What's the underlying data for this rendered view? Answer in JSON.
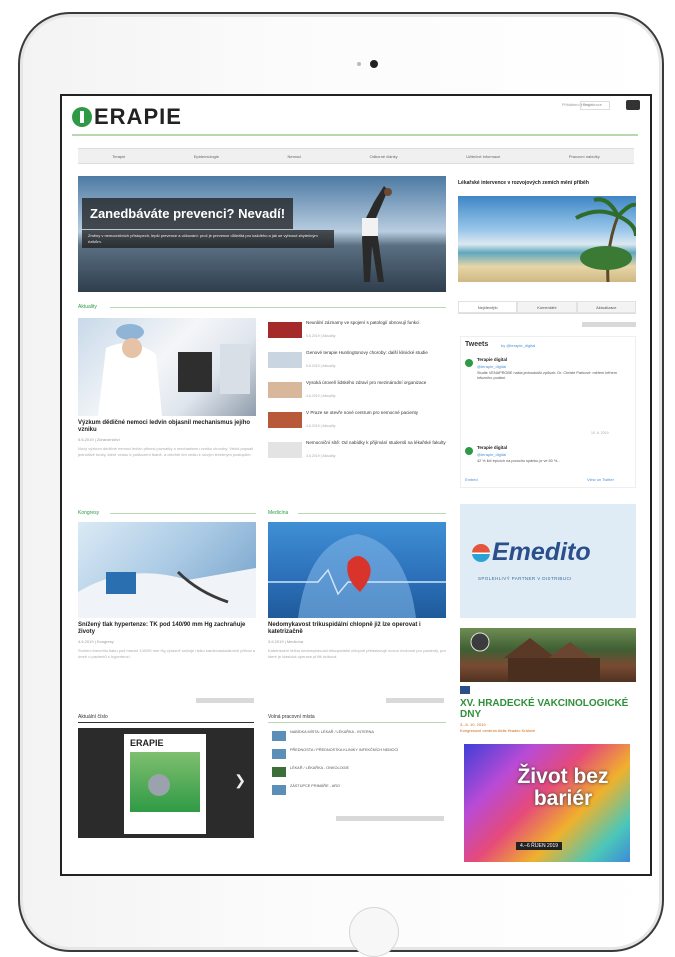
{
  "site": {
    "logo_text": "ERAPIE",
    "top_links": "Přihlášení | Registrace",
    "search_placeholder": "Hledat"
  },
  "nav": {
    "items": [
      "Terapie",
      "Epidemiologie",
      "Nemoci",
      "Odborné články",
      "Užitečné informace",
      "Pracovní nabídky"
    ]
  },
  "hero": {
    "title": "Zanedbáváte prevenci? Nevadí!",
    "text": "Změny v nemocničních přístupech, lepší prevence a očkování: proč je prevence důležitá pro každého a jak se vyhnout zbytečným rizikům."
  },
  "sidebar_feature": {
    "title": "Lékařské intervence v rozvojových zemích mění příběh"
  },
  "sections": {
    "aktuality": "Aktuality",
    "kongresy": "Kongresy",
    "medicina": "Medicína",
    "aktualni_cislo": "Aktuální číslo",
    "volna_mista": "Volná pracovní místa"
  },
  "articles": {
    "main": {
      "title": "Výzkum dědičné nemoci ledvin objasnil mechanismus jejího vzniku",
      "meta": "5.6.2019 | Zdravotnictví",
      "text": "Nový výzkum dědičné nemoci ledvin přinesl poznatky o mechanismu vzniku choroby. Vědci popsali jednotlivé kroky, které vedou k poškození tkáně, a otevřeli tím cestu k novým léčebným postupům."
    },
    "kongres": {
      "title": "Snížený tlak hypertenze: TK pod 140/90 mm Hg zachraňuje životy",
      "meta": "4.6.2019 | Kongresy",
      "text": "Snížení krevního tlaku pod hranici 140/90 mm Hg výrazně snižuje riziko kardiovaskulárních příhod a úmrtí u pacientů s hypertenzí."
    },
    "medicina": {
      "title": "Nedomykavost trikuspidální chlopně již lze operovat i katetrizačně",
      "meta": "3.6.2019 | Medicína",
      "text": "Katetrizační léčba nedomykavosti trikuspidální chlopně představuje novou možnost pro pacienty, pro které je klasická operace příliš riziková."
    }
  },
  "news": [
    {
      "title": "Neurální záznamy ve spojení s patologií obnovují funkci",
      "meta": "5.6.2019 | Aktuality"
    },
    {
      "title": "Genové terapie Huntingtonovy choroby: další klinické studie",
      "meta": "5.6.2019 | Aktuality"
    },
    {
      "title": "Vysoká úroveň lidského zdraví pro mezinárodní organizace",
      "meta": "4.6.2019 | Aktuality"
    },
    {
      "title": "V Praze se otevře nové centrum pro nemocné pacienty",
      "meta": "4.6.2019 | Aktuality"
    },
    {
      "title": "Nemocniční sítě: Od nabídky k přijímání studentů na lékařské fakulty",
      "meta": "3.6.2019 | Aktuality"
    }
  ],
  "tabs": [
    "Nejčtenější",
    "Komentáře",
    "Aktualizace"
  ],
  "tweets": {
    "heading": "Tweets",
    "by": "by @terapie_digital",
    "items": [
      {
        "name": "Terapie digital",
        "handle": "@terapie_digital",
        "text": "Studie VENAPROBE našla jednodušší způsob. Dr. Christe Parkové: měření během infuzního podání.",
        "date": "10. 6. 2019"
      },
      {
        "name": "Terapie digital",
        "handle": "@terapie_digital",
        "text": "42 % lidí trpících na poruchu spánku je ve 50 %...",
        "date": ""
      }
    ],
    "embed": "Embed",
    "view_on": "View on Twitter"
  },
  "ads": {
    "emedito_logo": "Emedito",
    "emedito_sub": "SPOLEHLIVÝ PARTNER V DISTRIBUCI",
    "vak_title": "XV. HRADECKÉ VAKCINOLOGICKÉ DNY",
    "vak_date": "3.–5. 10. 2019",
    "vak_place": "Kongresové centrum Aldis Hradec Králové",
    "zivot_title": "Život bez bariér",
    "zivot_date": "4.–6 ŘÍJEN 2019"
  },
  "magazine": {
    "logo": "ERAPIE"
  },
  "jobs": [
    "NABÍDKA MÍSTA: LÉKAŘ / LÉKAŘKA - INTERNA",
    "PŘEDNOSTA / PŘEDNOSTKA KLINIKY INFEKČNÍCH NEMOCÍ",
    "LÉKAŘ / LÉKAŘKA - ONKOLOGIE",
    "ZÁSTUPCE PRIMÁŘE - ARO"
  ]
}
